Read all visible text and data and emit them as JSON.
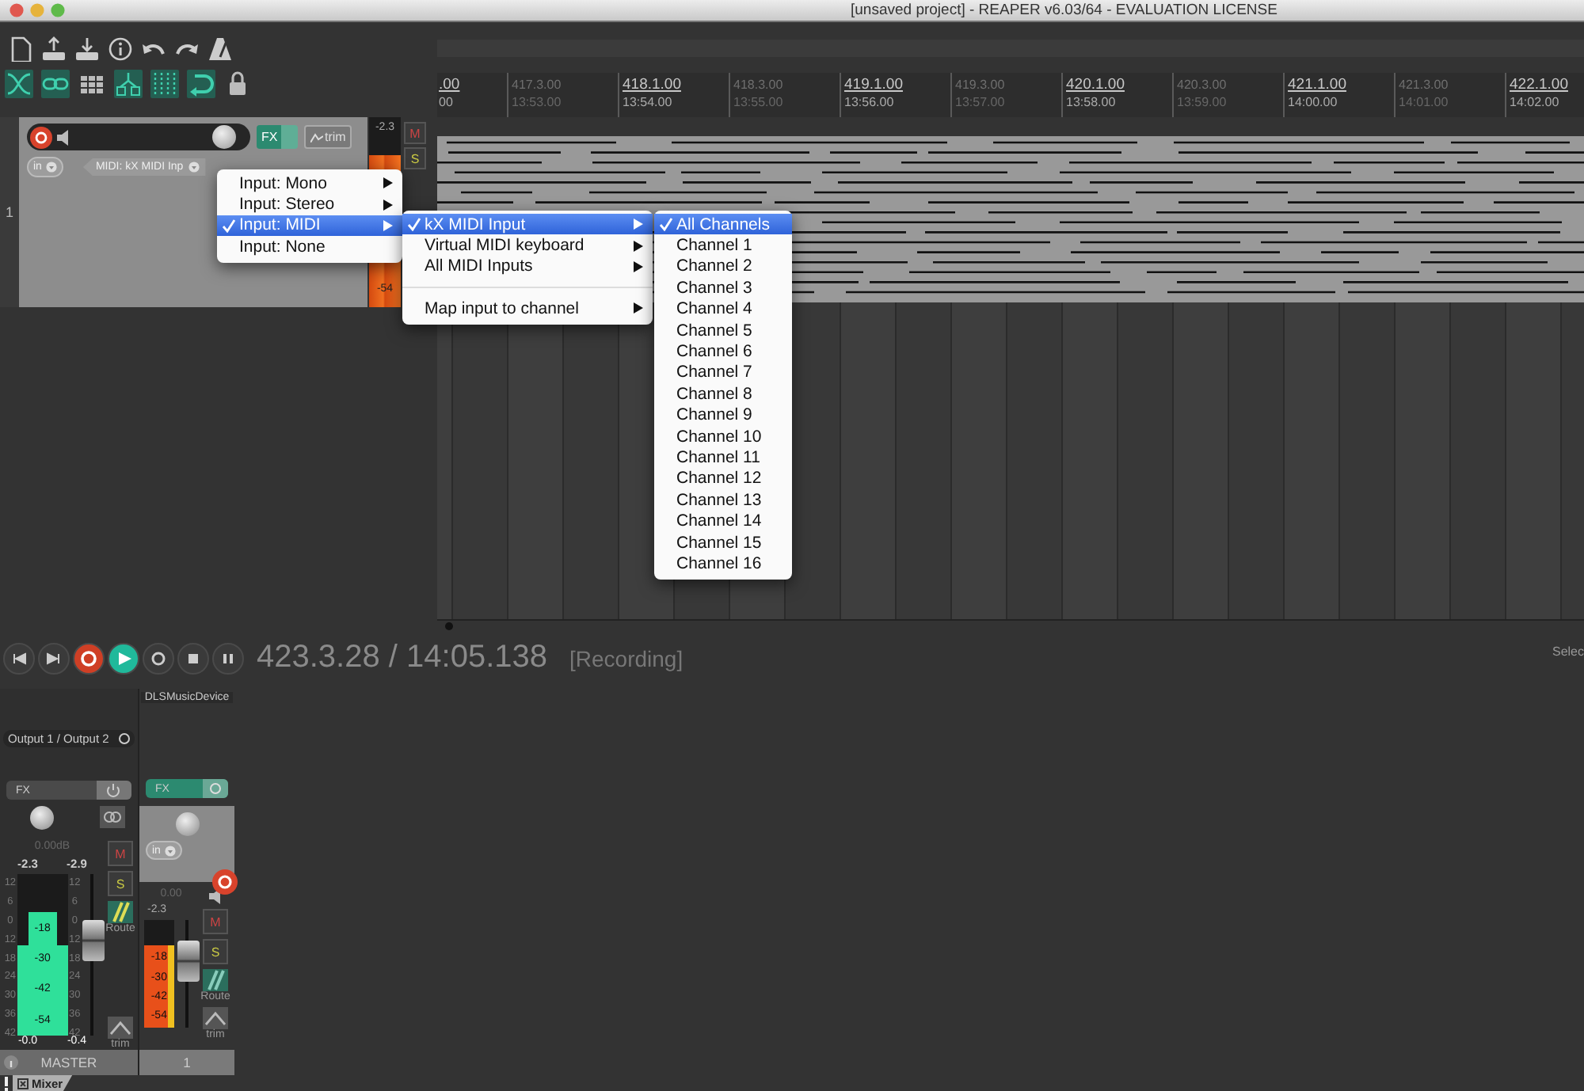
{
  "window": {
    "title": "[unsaved project] - REAPER v6.03/64 - EVALUATION LICENSE"
  },
  "toolbar": {
    "actions": [
      {
        "kind": "new"
      },
      {
        "kind": "open"
      },
      {
        "kind": "save"
      },
      {
        "kind": "info"
      },
      {
        "kind": "undo"
      },
      {
        "kind": "redo"
      },
      {
        "kind": "metronome"
      }
    ],
    "toggles": [
      {
        "kind": "crossfade",
        "on": true
      },
      {
        "kind": "link",
        "on": true
      },
      {
        "kind": "grid",
        "on": false
      },
      {
        "kind": "ripple",
        "on": true
      },
      {
        "kind": "snap",
        "on": true
      },
      {
        "kind": "loop",
        "on": true
      },
      {
        "kind": "lock",
        "on": false
      }
    ]
  },
  "ruler": {
    "marks": [
      {
        "bar": ".00",
        "time": "00",
        "major": true
      },
      {
        "bar": "417.3.00",
        "time": "13:53.00",
        "major": false
      },
      {
        "bar": "418.1.00",
        "time": "13:54.00",
        "major": true
      },
      {
        "bar": "418.3.00",
        "time": "13:55.00",
        "major": false
      },
      {
        "bar": "419.1.00",
        "time": "13:56.00",
        "major": true
      },
      {
        "bar": "419.3.00",
        "time": "13:57.00",
        "major": false
      },
      {
        "bar": "420.1.00",
        "time": "13:58.00",
        "major": true
      },
      {
        "bar": "420.3.00",
        "time": "13:59.00",
        "major": false
      },
      {
        "bar": "421.1.00",
        "time": "14:00.00",
        "major": true
      },
      {
        "bar": "421.3.00",
        "time": "14:01.00",
        "major": false
      },
      {
        "bar": "422.1.00",
        "time": "14:02.00",
        "major": true
      }
    ]
  },
  "track": {
    "number": "1",
    "record_armed": true,
    "volume": {
      "level": 0.93
    },
    "fx": {
      "label": "FX",
      "enabled": true
    },
    "trim": "trim",
    "input": "in",
    "midi_input": "MIDI: kX MIDI Inp",
    "meter": {
      "level": 0.8,
      "peak": "-2.3",
      "floor": "-54"
    },
    "mute": "M",
    "solo": "S"
  },
  "menus": [
    {
      "items": [
        {
          "kind": "item",
          "label": "Input: Mono",
          "checked": false,
          "selected": false,
          "submenu": true
        },
        {
          "kind": "item",
          "label": "Input: Stereo",
          "checked": false,
          "selected": false,
          "submenu": true
        },
        {
          "kind": "item",
          "label": "Input: MIDI",
          "checked": true,
          "selected": true,
          "submenu": true
        },
        {
          "kind": "item",
          "label": "Input: None",
          "checked": false,
          "selected": false,
          "submenu": false
        }
      ]
    },
    {
      "items": [
        {
          "kind": "item",
          "label": "kX MIDI Input",
          "checked": true,
          "selected": true,
          "submenu": true
        },
        {
          "kind": "item",
          "label": "Virtual MIDI keyboard",
          "checked": false,
          "selected": false,
          "submenu": true
        },
        {
          "kind": "item",
          "label": "All MIDI Inputs",
          "checked": false,
          "selected": false,
          "submenu": true
        },
        {
          "kind": "separator"
        },
        {
          "kind": "item",
          "label": "Map input to channel",
          "checked": false,
          "selected": false,
          "submenu": true
        }
      ]
    },
    {
      "items": [
        {
          "kind": "item",
          "label": "All Channels",
          "checked": true,
          "selected": true,
          "submenu": false
        },
        {
          "kind": "item",
          "label": "Channel 1",
          "checked": false,
          "selected": false,
          "submenu": false
        },
        {
          "kind": "item",
          "label": "Channel 2",
          "checked": false,
          "selected": false,
          "submenu": false
        },
        {
          "kind": "item",
          "label": "Channel 3",
          "checked": false,
          "selected": false,
          "submenu": false
        },
        {
          "kind": "item",
          "label": "Channel 4",
          "checked": false,
          "selected": false,
          "submenu": false
        },
        {
          "kind": "item",
          "label": "Channel 5",
          "checked": false,
          "selected": false,
          "submenu": false
        },
        {
          "kind": "item",
          "label": "Channel 6",
          "checked": false,
          "selected": false,
          "submenu": false
        },
        {
          "kind": "item",
          "label": "Channel 7",
          "checked": false,
          "selected": false,
          "submenu": false
        },
        {
          "kind": "item",
          "label": "Channel 8",
          "checked": false,
          "selected": false,
          "submenu": false
        },
        {
          "kind": "item",
          "label": "Channel 9",
          "checked": false,
          "selected": false,
          "submenu": false
        },
        {
          "kind": "item",
          "label": "Channel 10",
          "checked": false,
          "selected": false,
          "submenu": false
        },
        {
          "kind": "item",
          "label": "Channel 11",
          "checked": false,
          "selected": false,
          "submenu": false
        },
        {
          "kind": "item",
          "label": "Channel 12",
          "checked": false,
          "selected": false,
          "submenu": false
        },
        {
          "kind": "item",
          "label": "Channel 13",
          "checked": false,
          "selected": false,
          "submenu": false
        },
        {
          "kind": "item",
          "label": "Channel 14",
          "checked": false,
          "selected": false,
          "submenu": false
        },
        {
          "kind": "item",
          "label": "Channel 15",
          "checked": false,
          "selected": false,
          "submenu": false
        },
        {
          "kind": "item",
          "label": "Channel 16",
          "checked": false,
          "selected": false,
          "submenu": false
        }
      ]
    }
  ],
  "transport": {
    "buttons": [
      {
        "kind": "previous",
        "on": false
      },
      {
        "kind": "next",
        "on": false
      },
      {
        "kind": "record",
        "on": true
      },
      {
        "kind": "play",
        "on": true
      },
      {
        "kind": "repeat",
        "on": false
      },
      {
        "kind": "stop",
        "on": false
      },
      {
        "kind": "pause",
        "on": false
      }
    ],
    "position": "423.3.28 / 14:05.138",
    "status": "[Recording]",
    "right_label": "Selec"
  },
  "mixer": {
    "master": {
      "output": "Output 1 / Output 2",
      "fx": {
        "label": "FX",
        "enabled": false
      },
      "volume_readout": "0.00dB",
      "peaks": [
        "-2.3",
        "-2.9"
      ],
      "left_scale": [
        "12",
        "6",
        "0",
        "12",
        "18",
        "24",
        "30",
        "36",
        "42"
      ],
      "meters": [
        {
          "level": 0.56
        },
        {
          "level": 0.76,
          "labels": [
            "-18",
            "-30",
            "-42",
            "-54"
          ]
        },
        {
          "level": 0.56
        }
      ],
      "right_scale": [
        "12",
        "6",
        "0",
        "12",
        "18",
        "24",
        "30",
        "36",
        "42"
      ],
      "bottom_readouts": [
        "-0.0",
        "-0.4"
      ],
      "fader": {
        "level": 0.62
      },
      "mute": "M",
      "solo": "S",
      "route": "Route",
      "trim": "trim",
      "name": "MASTER"
    },
    "track": {
      "name": "DLSMusicDevice",
      "fx": {
        "label": "FX",
        "enabled": true
      },
      "input": "in",
      "record_armed": true,
      "volume_readout": "0.00",
      "peak": "-2.3",
      "meter": {
        "level": 0.76,
        "labels": [
          "-18",
          "-30",
          "-42",
          "-54"
        ]
      },
      "fader": {
        "level": 0.68
      },
      "mute": "M",
      "solo": "S",
      "route": "Route",
      "trim": "trim",
      "number": "1"
    },
    "tab": "Mixer"
  }
}
